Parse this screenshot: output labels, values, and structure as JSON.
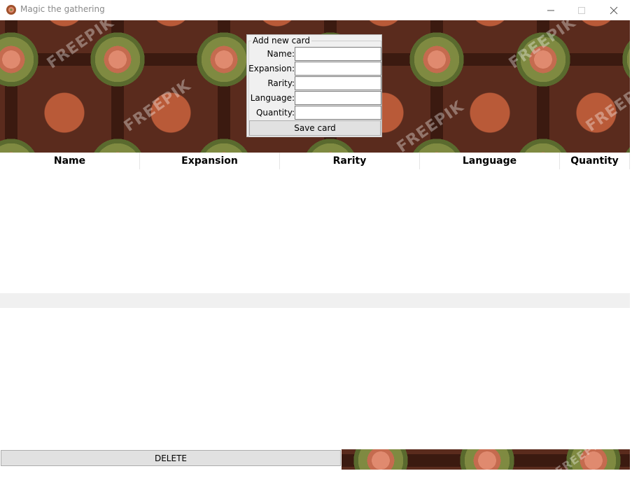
{
  "window": {
    "title": "Magic the gathering"
  },
  "banner": {
    "watermark": "FREEPIK"
  },
  "add_card": {
    "legend": "Add new card",
    "fields": [
      {
        "label": "Name:",
        "value": ""
      },
      {
        "label": "Expansion:",
        "value": ""
      },
      {
        "label": "Rarity:",
        "value": ""
      },
      {
        "label": "Language:",
        "value": ""
      },
      {
        "label": "Quantity:",
        "value": ""
      }
    ],
    "save_label": "Save card"
  },
  "table": {
    "columns": [
      "Name",
      "Expansion",
      "Rarity",
      "Language",
      "Quantity"
    ],
    "rows": []
  },
  "actions": {
    "delete_label": "DELETE"
  },
  "icons": [
    "app-icon",
    "minimize-icon",
    "maximize-icon",
    "close-icon"
  ]
}
